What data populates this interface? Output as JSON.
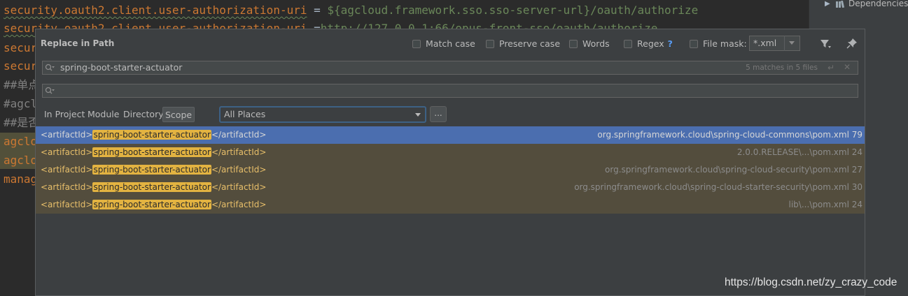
{
  "editor": {
    "lines": [
      {
        "key": "security.oauth2.client.user-authorization-uri",
        "eq": " = ",
        "val": "${agcloud.framework.sso.sso-server-url}/oauth/authorize"
      },
      {
        "key": "security.oauth2.client.user-authorization-uri",
        "eq": " =",
        "val": "http://127.0.0.1:66/opus-front-sso/oauth/authorize"
      },
      {
        "text": "secur"
      },
      {
        "text": "secur"
      },
      {
        "text": "##单点"
      },
      {
        "text": "#agcl"
      },
      {
        "text": "##是否"
      },
      {
        "text": "agclo"
      },
      {
        "text": "agclo"
      },
      {
        "text": "manag"
      }
    ]
  },
  "project_panel": {
    "item_label": "Dependencies",
    "item_icon": "library-icon"
  },
  "dialog": {
    "title": "Replace in Path",
    "options": {
      "match_case": "Match case",
      "preserve_case": "Preserve case",
      "words": "Words",
      "regex": "Regex",
      "regex_help": "?",
      "file_mask_label": "File mask:",
      "file_mask_value": "*.xml"
    },
    "search": {
      "value": "spring-boot-starter-actuator",
      "match_info": "5 matches in 5 files"
    },
    "replace": {
      "value": ""
    },
    "scopes": [
      "In Project",
      "Module",
      "Directory",
      "Scope"
    ],
    "selected_scope": "Scope",
    "scope_select": "All Places",
    "ellipsis": "...",
    "results": [
      {
        "open": "<artifactId>",
        "match": "spring-boot-starter-actuator",
        "close": "</artifactId>",
        "path": "org.springframework.cloud\\spring-cloud-commons\\pom.xml 79",
        "selected": true
      },
      {
        "open": "<artifactId>",
        "match": "spring-boot-starter-actuator",
        "close": "</artifactId>",
        "path": "2.0.0.RELEASE\\...\\pom.xml 24",
        "selected": false
      },
      {
        "open": "<artifactId>",
        "match": "spring-boot-starter-actuator",
        "close": "</artifactId>",
        "path": "org.springframework.cloud\\spring-cloud-security\\pom.xml 27",
        "selected": false
      },
      {
        "open": "<artifactId>",
        "match": "spring-boot-starter-actuator",
        "close": "</artifactId>",
        "path": "org.springframework.cloud\\spring-cloud-starter-security\\pom.xml 30",
        "selected": false
      },
      {
        "open": "<artifactId>",
        "match": "spring-boot-starter-actuator",
        "close": "</artifactId>",
        "path": "lib\\...\\pom.xml 24",
        "selected": false
      }
    ]
  },
  "watermark": "https://blog.csdn.net/zy_crazy_code",
  "colors": {
    "selection": "#4b6eaf",
    "match_highlight": "#e3b341",
    "row_background": "#534d3d"
  }
}
